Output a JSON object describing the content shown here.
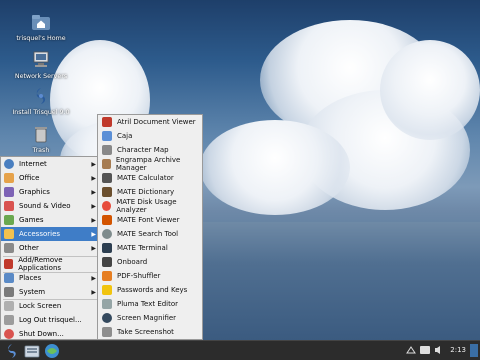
{
  "desktop": {
    "icons": [
      {
        "label": "trisquel's Home",
        "icon": "home-folder-icon"
      },
      {
        "label": "Network Servers",
        "icon": "network-servers-icon"
      },
      {
        "label": "Install Trisquel 9.0",
        "icon": "install-trisquel-icon"
      },
      {
        "label": "Trash",
        "icon": "trash-icon"
      }
    ]
  },
  "menu": {
    "items": [
      {
        "label": "Internet",
        "icon": "internet-icon"
      },
      {
        "label": "Office",
        "icon": "office-icon"
      },
      {
        "label": "Graphics",
        "icon": "graphics-icon"
      },
      {
        "label": "Sound & Video",
        "icon": "sound-video-icon"
      },
      {
        "label": "Games",
        "icon": "games-icon"
      },
      {
        "label": "Accessories",
        "icon": "accessories-icon"
      },
      {
        "label": "Other",
        "icon": "other-icon"
      },
      {
        "label": "Add/Remove Applications",
        "icon": "add-remove-icon"
      },
      {
        "label": "Places",
        "icon": "places-icon"
      },
      {
        "label": "System",
        "icon": "system-icon"
      },
      {
        "label": "Lock Screen",
        "icon": "lock-icon"
      },
      {
        "label": "Log Out trisquel...",
        "icon": "logout-icon"
      },
      {
        "label": "Shut Down...",
        "icon": "shutdown-icon"
      }
    ],
    "active": "Accessories"
  },
  "submenu": {
    "items": [
      "Atril Document Viewer",
      "Caja",
      "Character Map",
      "Engrampa Archive Manager",
      "MATE Calculator",
      "MATE Dictionary",
      "MATE Disk Usage Analyzer",
      "MATE Font Viewer",
      "MATE Search Tool",
      "MATE Terminal",
      "Onboard",
      "PDF-Shuffler",
      "Passwords and Keys",
      "Pluma Text Editor",
      "Screen Magnifier",
      "Take Screenshot"
    ]
  },
  "panel": {
    "clock": "2:13",
    "buttons": [
      "menu-icon",
      "file-manager-icon",
      "browser-icon"
    ]
  },
  "colors": {
    "highlight": "#3f7dc7",
    "menu_bg": "#ededed",
    "panel_bg": "#2c2c2c"
  }
}
